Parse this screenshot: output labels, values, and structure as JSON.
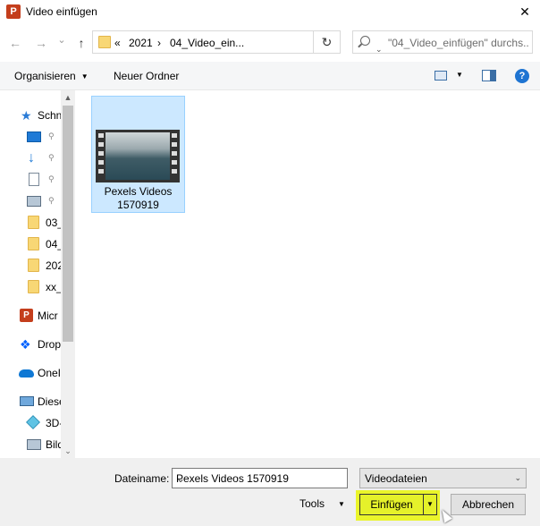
{
  "window": {
    "title": "Video einfügen",
    "app_icon_letter": "P",
    "close_glyph": "✕"
  },
  "address": {
    "back_glyph": "←",
    "forward_glyph": "→",
    "recent_glyph": "⌄",
    "up_glyph": "↑",
    "overflow": "«",
    "crumbs": [
      "2021",
      "04_Video_ein..."
    ],
    "separator": "›",
    "dropdown_glyph": "⌄",
    "refresh_glyph": "↻",
    "search_placeholder": "\"04_Video_einfügen\" durchs..."
  },
  "toolbar": {
    "organize_label": "Organisieren",
    "new_folder_label": "Neuer Ordner",
    "dropdown_glyph": "▼",
    "help_glyph": "?"
  },
  "sidebar": {
    "items": [
      {
        "label": "Schn",
        "icon": "star-icon"
      },
      {
        "label": "",
        "icon": "desktop-icon",
        "pinned": true
      },
      {
        "label": "",
        "icon": "download-arrow-icon",
        "pinned": true
      },
      {
        "label": "",
        "icon": "document-icon",
        "pinned": true
      },
      {
        "label": "",
        "icon": "pictures-icon",
        "pinned": true
      },
      {
        "label": "03_",
        "icon": "folder-icon"
      },
      {
        "label": "04_",
        "icon": "folder-icon"
      },
      {
        "label": "202",
        "icon": "folder-icon"
      },
      {
        "label": "xx_",
        "icon": "folder-icon"
      },
      {
        "label": "Micr",
        "icon": "powerpoint-icon"
      },
      {
        "label": "Drop",
        "icon": "dropbox-icon"
      },
      {
        "label": "OneI",
        "icon": "onedrive-icon"
      },
      {
        "label": "Diese",
        "icon": "computer-icon"
      },
      {
        "label": "3D-",
        "icon": "3d-objects-icon"
      },
      {
        "label": "Bild",
        "icon": "pictures-icon"
      }
    ],
    "pin_glyph": "⚲",
    "scroll_up_glyph": "▲",
    "scroll_down_glyph": "⌄"
  },
  "files": [
    {
      "name_line1": "Pexels Videos",
      "name_line2": "1570919",
      "selected": true,
      "type": "video"
    }
  ],
  "footer": {
    "filename_label": "Dateiname:",
    "filename_value": "Pexels Videos 1570919",
    "filetype_value": "Videodateien",
    "dropdown_glyph": "⌄",
    "tools_label": "Tools",
    "tools_dd_glyph": "▼",
    "insert_label": "Einfügen",
    "insert_dd_glyph": "▼",
    "cancel_label": "Abbrechen",
    "highlight_color": "#eaf52a"
  }
}
